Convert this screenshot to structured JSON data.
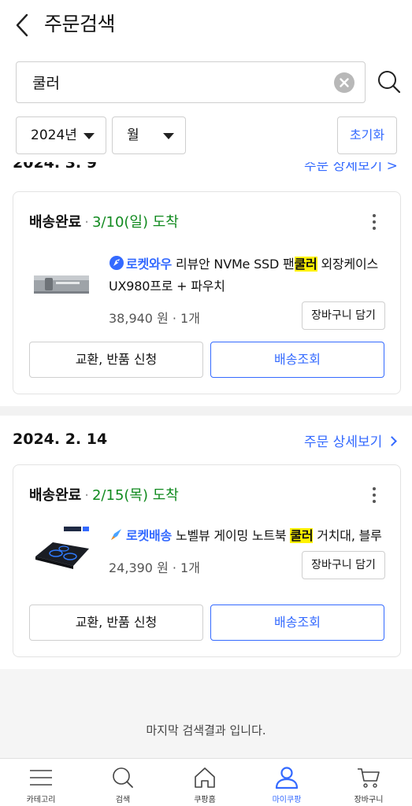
{
  "header": {
    "title": "주문검색"
  },
  "search": {
    "value": "쿨러"
  },
  "filters": {
    "year": "2024년",
    "month": "월",
    "reset_label": "초기화"
  },
  "clipped_previous": {
    "date": "2024. 3. 9",
    "link": "주문 상세보기 >"
  },
  "orders": [
    {
      "status": "배송완료",
      "arrival": "3/10(일) 도착",
      "badge": "로켓와우",
      "title_pre": " 리뷰안 NVMe SSD 팬",
      "title_hl": "쿨러",
      "title_post": " 외장케이스 UX980프로 + 파우치",
      "price_qty": "38,940 원 · 1개",
      "cart_label": "장바구니 담기",
      "return_label": "교환, 반품 신청",
      "track_label": "배송조회"
    },
    {
      "date": "2024. 2. 14",
      "detail_link": "주문 상세보기",
      "status": "배송완료",
      "arrival": "2/15(목) 도착",
      "badge": "로켓배송",
      "title_pre": " 노벨뷰 게이밍 노트북 ",
      "title_hl": "쿨러",
      "title_post": " 거치대, 블루",
      "price_qty": "24,390 원 · 1개",
      "cart_label": "장바구니 담기",
      "return_label": "교환, 반품 신청",
      "track_label": "배송조회"
    }
  ],
  "footer_message": "마지막 검색결과 입니다.",
  "tabs": [
    {
      "label": "카테고리",
      "icon": "menu-icon"
    },
    {
      "label": "검색",
      "icon": "search-icon"
    },
    {
      "label": "쿠팡홈",
      "icon": "home-icon"
    },
    {
      "label": "마이쿠팡",
      "icon": "user-icon"
    },
    {
      "label": "장바구니",
      "icon": "cart-icon"
    }
  ],
  "colors": {
    "accent": "#346aff",
    "arrival": "#118a1f",
    "highlight": "#fff200"
  }
}
